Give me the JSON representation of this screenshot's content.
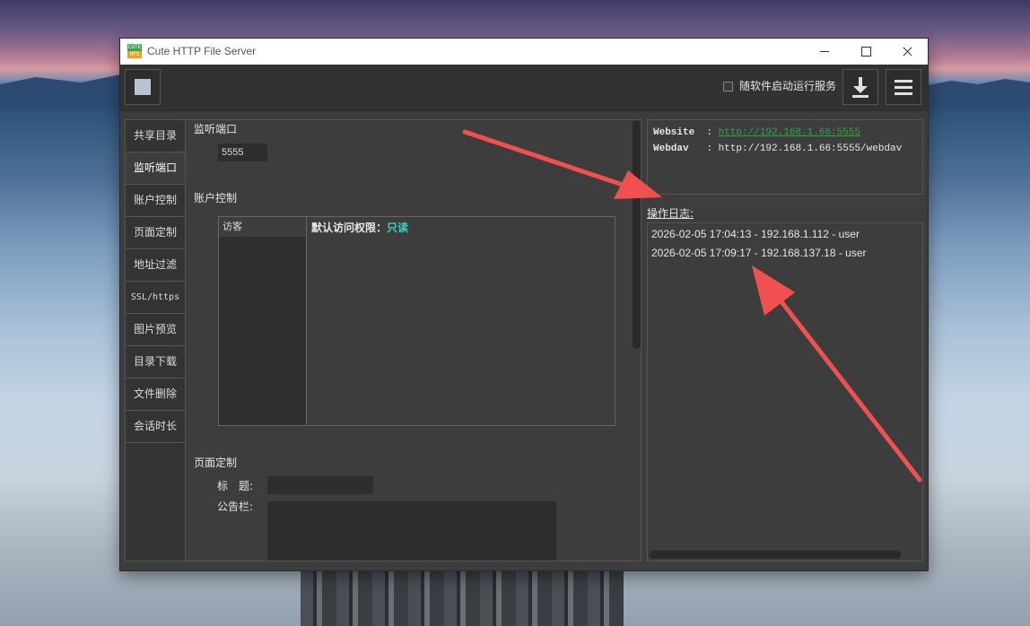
{
  "window": {
    "title": "Cute HTTP File Server",
    "icon_text_top": "CUTE",
    "icon_text_bottom": "HFS"
  },
  "toolbar": {
    "autostart_label": "随软件启动运行服务",
    "autostart_checked": false,
    "stop_icon": "square-stop-icon",
    "download_icon": "download-icon",
    "menu_icon": "hamburger-menu-icon"
  },
  "nav": {
    "items": [
      "共享目录",
      "监听端口",
      "账户控制",
      "页面定制",
      "地址过滤",
      "SSL/https",
      "图片预览",
      "目录下载",
      "文件删除",
      "会话时长"
    ],
    "active": "监听端口"
  },
  "main": {
    "port_section": "监听端口",
    "port_value": "5555",
    "account_section": "账户控制",
    "account_list": [
      "访客"
    ],
    "permission_label": "默认访问权限：",
    "permission_value": "只读",
    "page_section": "页面定制",
    "title_label": "标　题:",
    "notice_label": "公告栏:"
  },
  "info": {
    "website_label": "Website",
    "website_url": "http://192.168.1.66:5555",
    "webdav_label": "Webdav",
    "webdav_url": "http://192.168.1.66:5555/webdav"
  },
  "log": {
    "label": "操作日志:",
    "lines": [
      "2026-02-05 17:04:13 - 192.168.1.112 - user",
      "2026-02-05 17:09:17 - 192.168.137.18 - user"
    ]
  },
  "colors": {
    "accent_green": "#2aa84a",
    "readonly_teal": "#3fd0c0",
    "arrow_red": "#f05050"
  }
}
